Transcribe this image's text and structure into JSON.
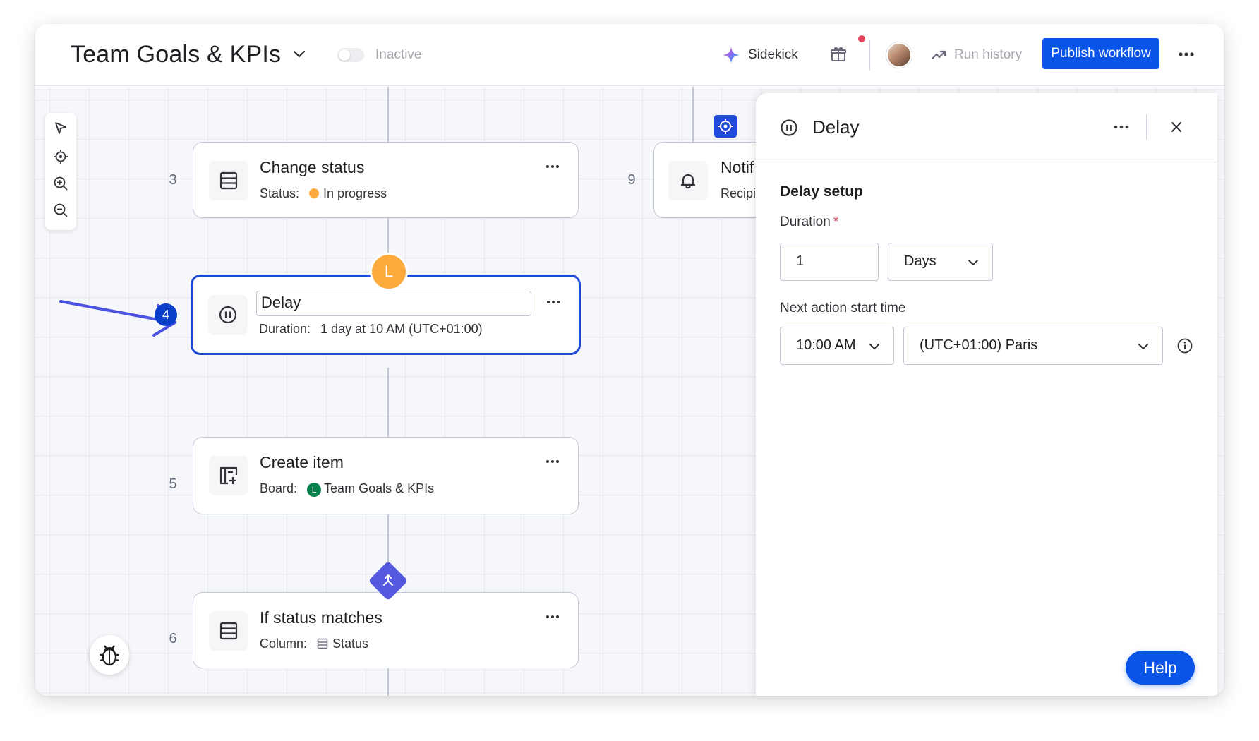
{
  "header": {
    "title": "Team Goals & KPIs",
    "toggle_label": "Inactive",
    "sidekick_label": "Sidekick",
    "run_history_label": "Run history",
    "publish_label": "Publish workflow"
  },
  "canvas": {
    "steps": [
      {
        "num": "3",
        "title": "Change status",
        "sub_label": "Status:",
        "sub_value": "In progress"
      },
      {
        "num": "4",
        "title": "Delay",
        "sub_label": "Duration:",
        "sub_value": "1 day at 10 AM (UTC+01:00)",
        "badge": "L"
      },
      {
        "num": "5",
        "title": "Create item",
        "sub_label": "Board:",
        "sub_value": "Team Goals & KPIs",
        "badge": "L"
      },
      {
        "num": "6",
        "title": "If status matches",
        "sub_label": "Column:",
        "sub_value": "Status"
      },
      {
        "num": "9",
        "title": "Notif",
        "sub_label": "Recipi"
      }
    ]
  },
  "panel": {
    "title": "Delay",
    "section_title": "Delay setup",
    "duration_label": "Duration",
    "required_mark": "*",
    "duration_value": "1",
    "unit_value": "Days",
    "next_action_label": "Next action start time",
    "time_value": "10:00 AM",
    "timezone_value": "(UTC+01:00) Paris"
  },
  "help_label": "Help",
  "colors": {
    "accent": "#0a55e8",
    "selected_border": "#1f4ad8",
    "status_orange": "#fdab3d",
    "board_green": "#037f4c",
    "branch_purple": "#5559df"
  }
}
